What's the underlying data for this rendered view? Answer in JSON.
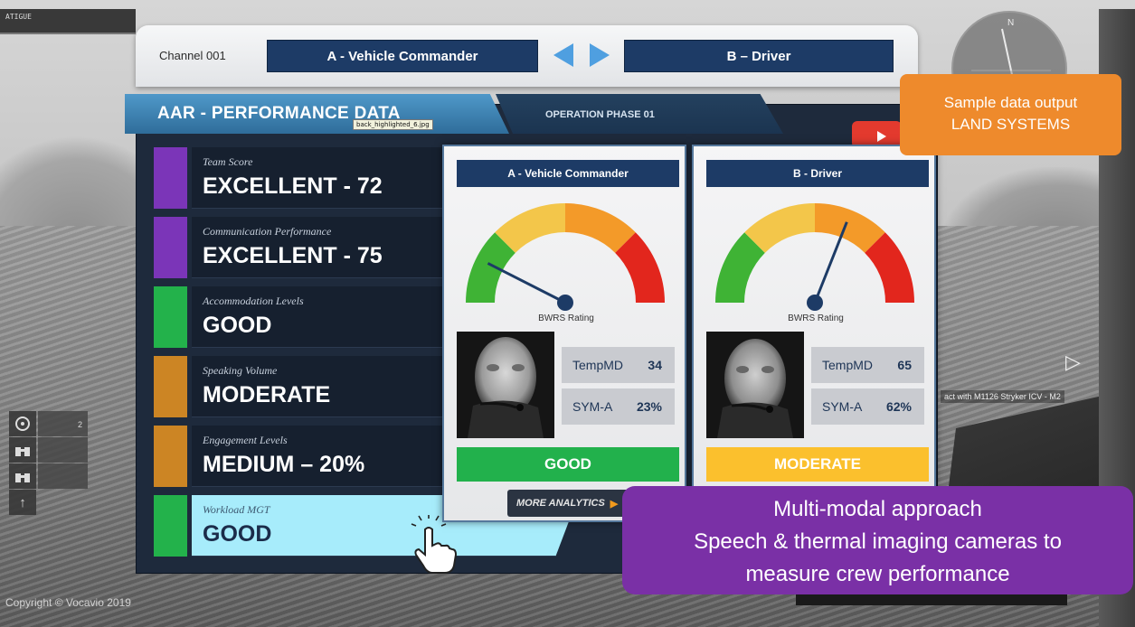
{
  "scene": {
    "fatigue_label": "ATIGUE",
    "compass_north": "N",
    "copyright": "Copyright © Vocavio 2019",
    "right_label": "act with M1126 Stryker ICV - M2",
    "hud_count": "2"
  },
  "header": {
    "channel_label": "Channel 001",
    "crew_a": "A - Vehicle Commander",
    "crew_b": "B – Driver"
  },
  "panel": {
    "title": "AAR - PERFORMANCE DATA",
    "tooltip": "back_highlighted_6.jpg",
    "phase": "OPERATION PHASE 01"
  },
  "metrics": [
    {
      "label": "Team Score",
      "value": "EXCELLENT - 72",
      "color": "#7b35b8"
    },
    {
      "label": "Communication Performance",
      "value": "EXCELLENT - 75",
      "color": "#7b35b8"
    },
    {
      "label": "Accommodation Levels",
      "value": "GOOD",
      "color": "#23b24b"
    },
    {
      "label": "Speaking Volume",
      "value": "MODERATE",
      "color": "#cc8524"
    },
    {
      "label": "Engagement Levels",
      "value": "MEDIUM – 20%",
      "color": "#cc8524"
    },
    {
      "label": "Workload MGT",
      "value": "GOOD",
      "color": "#23b24b"
    }
  ],
  "cards": [
    {
      "title": "A - Vehicle Commander",
      "gauge_label": "BWRS Rating",
      "gauge_level": 0.15,
      "stats": [
        {
          "name": "TempMD",
          "value": "34"
        },
        {
          "name": "SYM-A",
          "value": "23%"
        }
      ],
      "status": "GOOD",
      "status_color": "#22b14c",
      "more": "MORE ANALYTICS"
    },
    {
      "title": "B - Driver",
      "gauge_label": "BWRS Rating",
      "gauge_level": 0.62,
      "stats": [
        {
          "name": "TempMD",
          "value": "65"
        },
        {
          "name": "SYM-A",
          "value": "62%"
        }
      ],
      "status": "MODERATE",
      "status_color": "#fbc02d"
    }
  ],
  "callouts": {
    "orange_line1": "Sample data output",
    "orange_line2": "LAND SYSTEMS",
    "purple_line1": "Multi-modal approach",
    "purple_line2": "Speech & thermal imaging cameras to",
    "purple_line3": "measure crew performance"
  },
  "colors": {
    "navy": "#1d3b66",
    "gauge_green": "#3fb335",
    "gauge_yellow": "#f3c64a",
    "gauge_orange": "#f39a29",
    "gauge_red": "#e2261d"
  }
}
